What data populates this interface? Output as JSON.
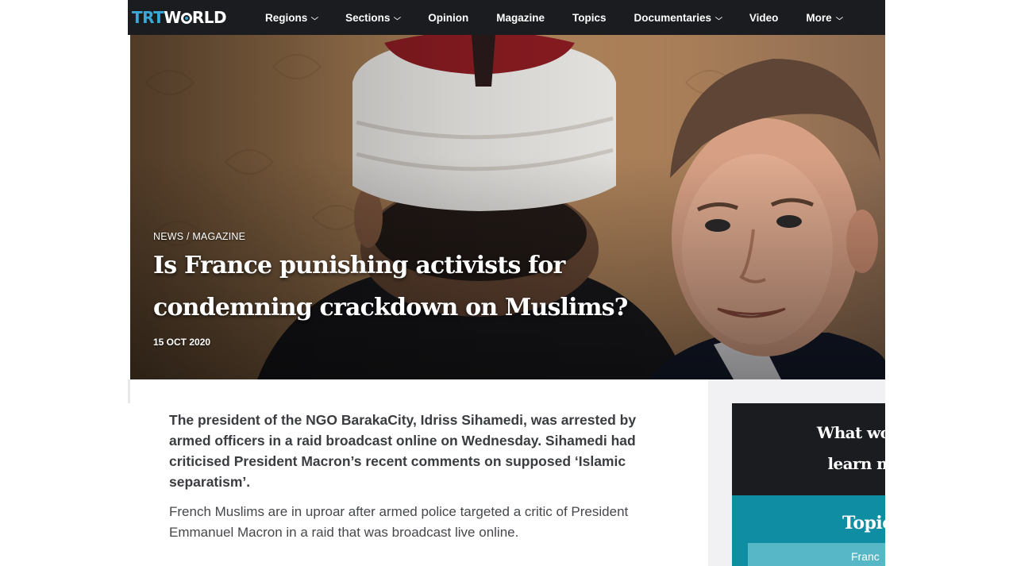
{
  "nav": {
    "logo_trt": "TRT",
    "logo_world_w": "W",
    "logo_world_rest": "RLD",
    "items": [
      {
        "label": "Regions",
        "dropdown": true
      },
      {
        "label": "Sections",
        "dropdown": true
      },
      {
        "label": "Opinion",
        "dropdown": false
      },
      {
        "label": "Magazine",
        "dropdown": false
      },
      {
        "label": "Topics",
        "dropdown": false
      },
      {
        "label": "Documentaries",
        "dropdown": true
      },
      {
        "label": "Video",
        "dropdown": false
      },
      {
        "label": "More",
        "dropdown": true
      }
    ]
  },
  "hero": {
    "kicker": "NEWS / MAGAZINE",
    "headline_line1": "Is France punishing activists for",
    "headline_line2": "condemning crackdown on Muslims?",
    "date": "15 OCT 2020"
  },
  "article": {
    "lead": "The president of the NGO BarakaCity, Idriss Sihamedi, was arrested by armed officers in a raid broadcast online on Wednesday. Sihamedi had criticised President Macron’s recent comments on supposed ‘Islamic separatism’.",
    "paragraph1": "French Muslims are in uproar after armed police targeted a critic of President Emmanuel Macron in a raid that was broadcast live online."
  },
  "sidebar": {
    "promo_line1": "What would y",
    "promo_line2": "learn more",
    "topics_title": "Topic",
    "topic_chip": "Franc"
  },
  "colors": {
    "nav_bg": "#1b1c20",
    "brand_blue": "#3aa9d8",
    "topics_teal": "#0f8ea3",
    "chip_teal": "#57b7c6"
  }
}
